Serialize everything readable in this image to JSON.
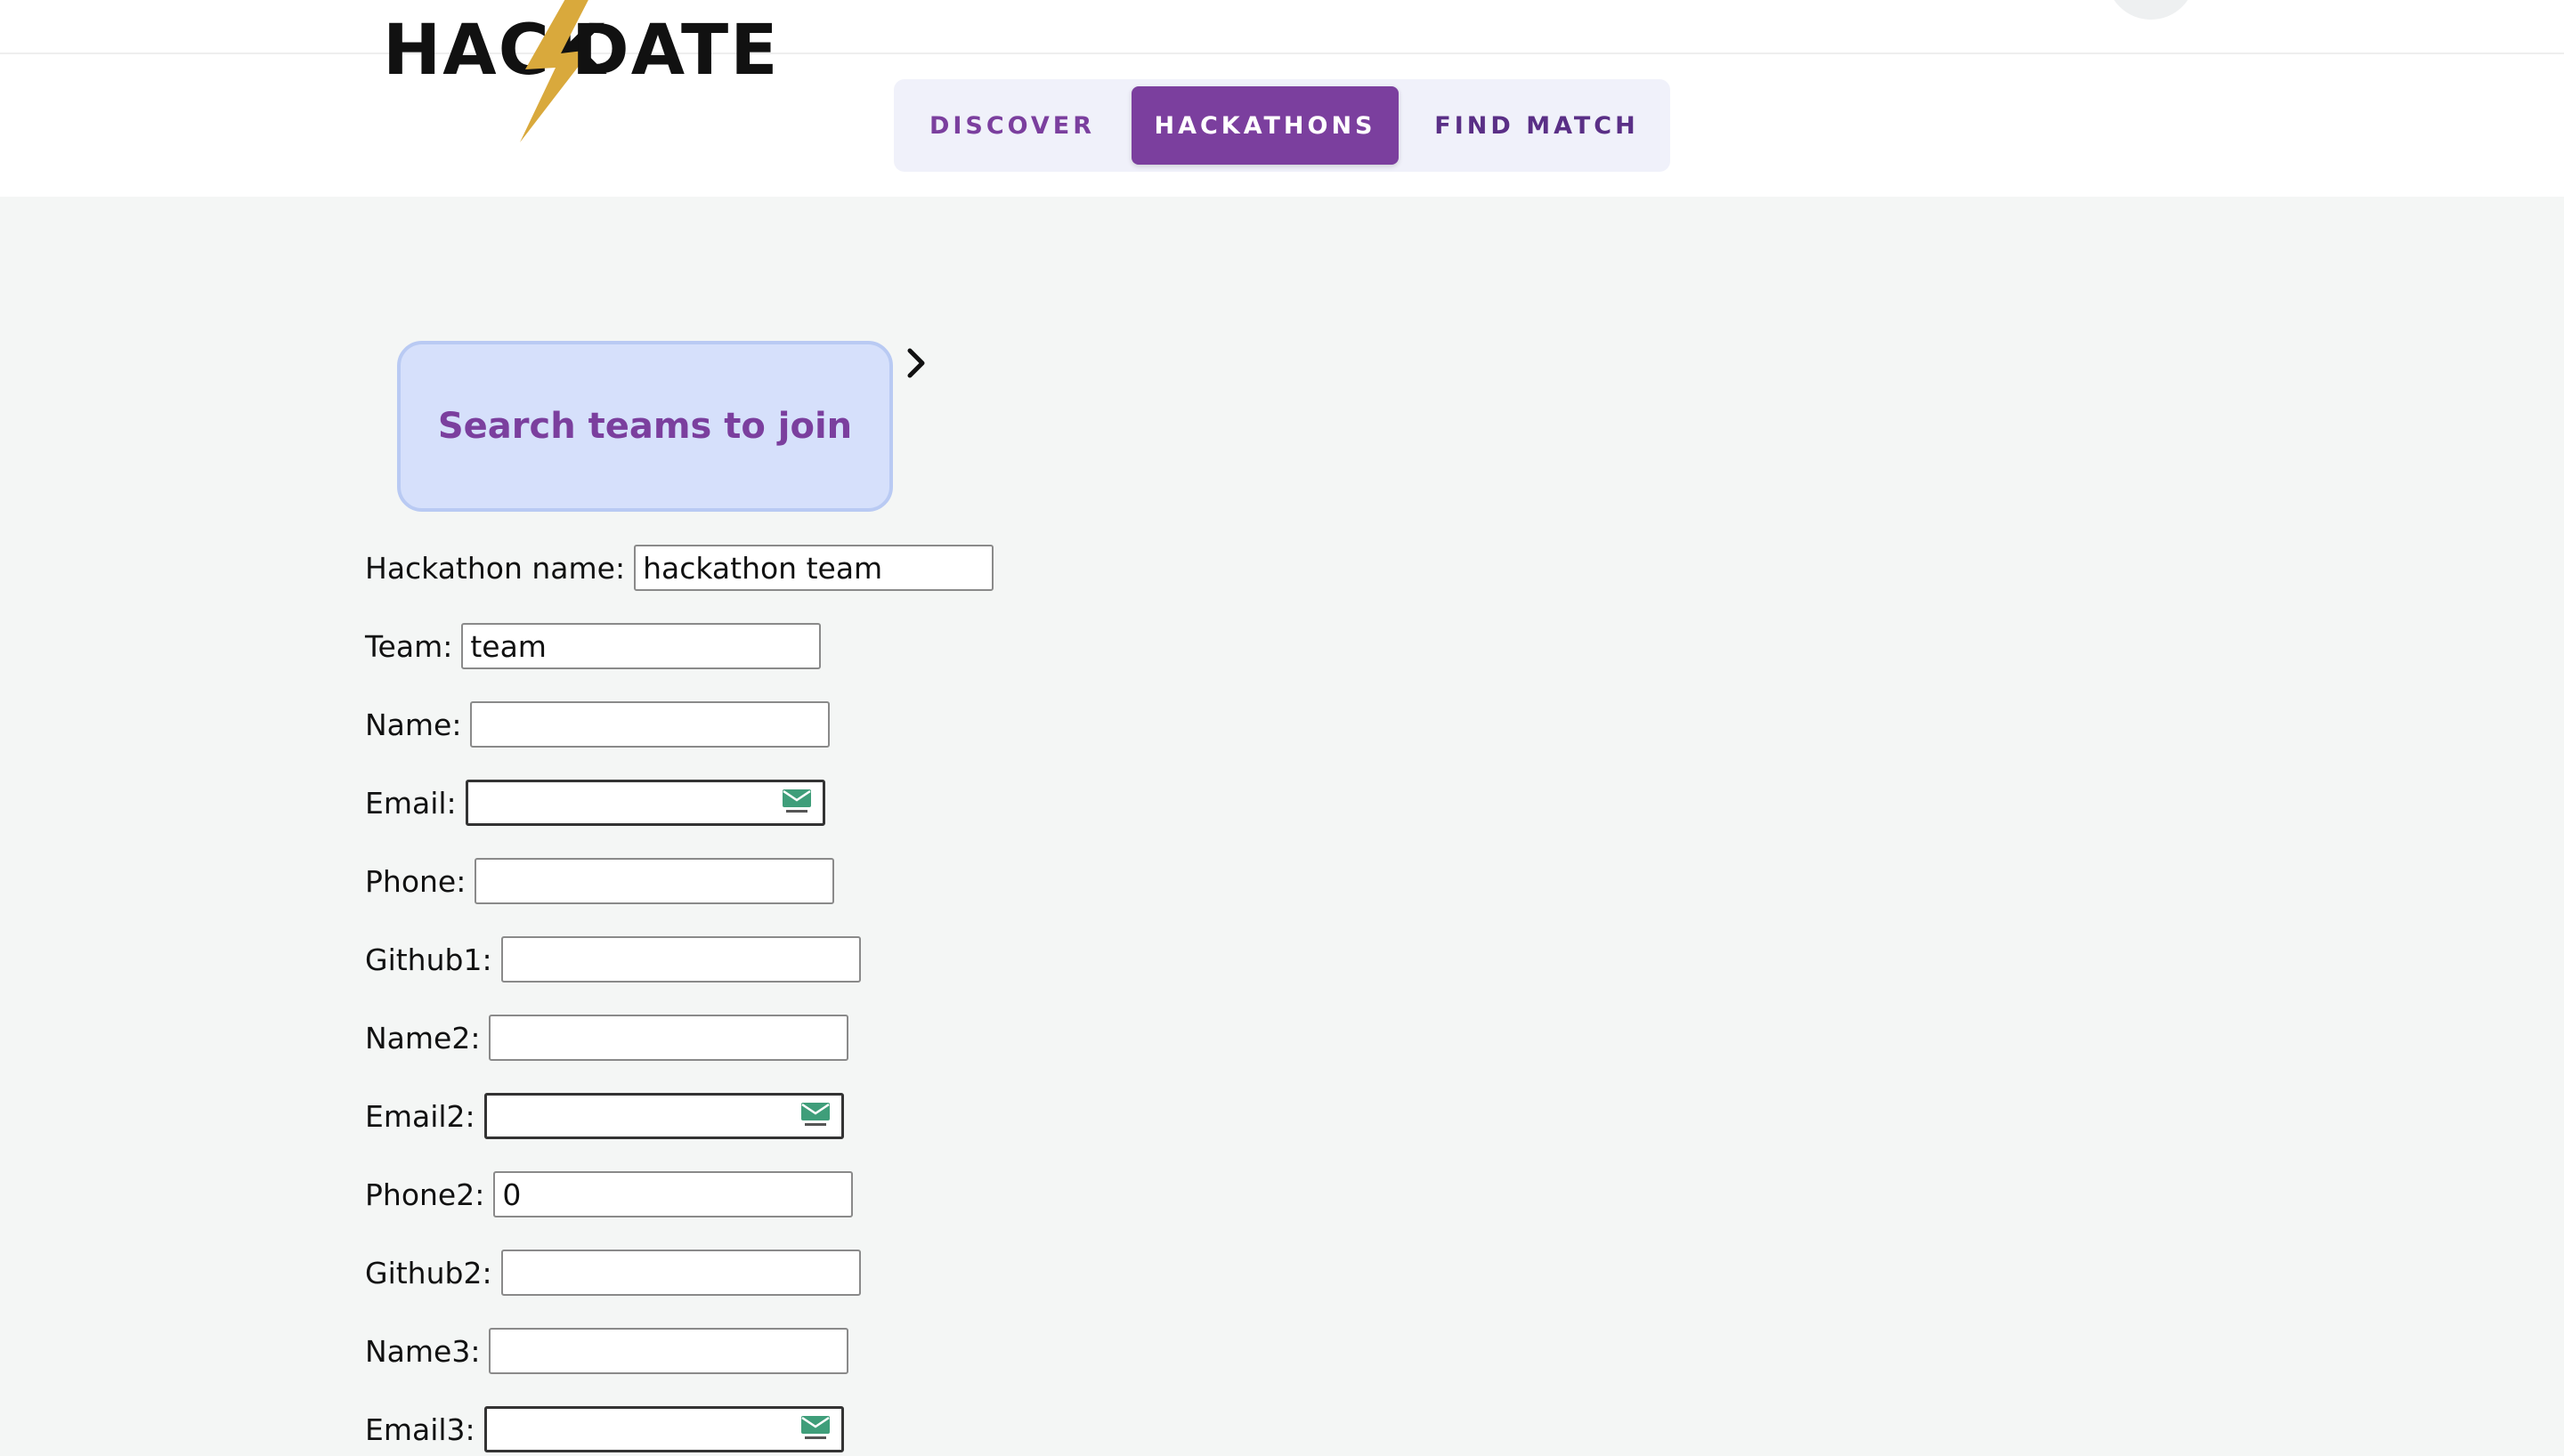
{
  "brand": {
    "logo_left": "HACK",
    "logo_right": "DATE"
  },
  "nav": {
    "tabs": [
      {
        "label": "DISCOVER"
      },
      {
        "label": "HACKATHONS"
      },
      {
        "label": "FIND MATCH"
      }
    ],
    "active": "HACKATHONS"
  },
  "search_card": {
    "label": "Search teams to join"
  },
  "form": {
    "hackathon_name": {
      "label": "Hackathon name:",
      "value": "hackathon team"
    },
    "team": {
      "label": "Team:",
      "value": "team"
    },
    "name": {
      "label": "Name:",
      "value": ""
    },
    "email": {
      "label": "Email:",
      "value": ""
    },
    "phone": {
      "label": "Phone:",
      "value": ""
    },
    "github1": {
      "label": "Github1:",
      "value": ""
    },
    "name2": {
      "label": "Name2:",
      "value": ""
    },
    "email2": {
      "label": "Email2:",
      "value": ""
    },
    "phone2": {
      "label": "Phone2:",
      "value": "0"
    },
    "github2": {
      "label": "Github2:",
      "value": ""
    },
    "name3": {
      "label": "Name3:",
      "value": ""
    },
    "email3": {
      "label": "Email3:",
      "value": ""
    }
  },
  "colors": {
    "brand_purple": "#7b3f9e",
    "card_blue": "#d6e0fb",
    "page_bg": "#f4f6f5",
    "bolt_gold": "#d9a93c"
  },
  "icons": {
    "chevron": "chevron-right-icon",
    "email_field_extension": "mail-icon"
  }
}
